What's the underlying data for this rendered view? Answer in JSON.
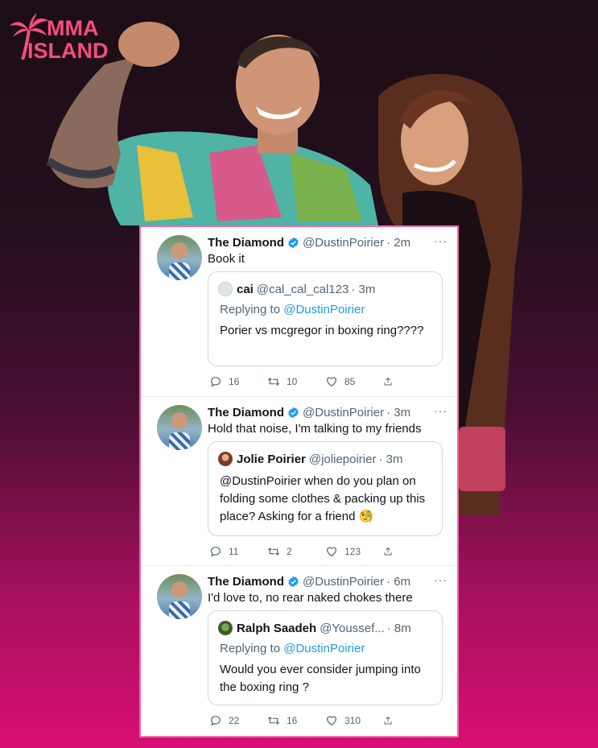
{
  "brand": {
    "line1": "MMA",
    "line2": "ISLAND",
    "color": "#f44e7c"
  },
  "tweets": [
    {
      "name": "The Diamond",
      "handle": "@DustinPoirier",
      "time": "· 2m",
      "text": "Book it",
      "quote": {
        "name": "cai",
        "handle": "@cal_cal_cal123",
        "time": "· 3m",
        "replying_prefix": "Replying to ",
        "replying_to": "@DustinPoirier",
        "text": "Porier vs mcgregor in boxing ring????"
      },
      "replies": "16",
      "retweets": "10",
      "likes": "85"
    },
    {
      "name": "The Diamond",
      "handle": "@DustinPoirier",
      "time": "· 3m",
      "text": "Hold that noise, I'm talking to my friends",
      "quote": {
        "name": "Jolie Poirier",
        "handle": "@joliepoirier",
        "time": "· 3m",
        "text": "@DustinPoirier when do you plan on folding some clothes & packing up this place? Asking for a friend 🧐"
      },
      "replies": "11",
      "retweets": "2",
      "likes": "123"
    },
    {
      "name": "The Diamond",
      "handle": "@DustinPoirier",
      "time": "· 6m",
      "text": "I'd love to, no rear naked chokes there",
      "quote": {
        "name": "Ralph Saadeh",
        "handle": "@Youssef...",
        "time": "· 8m",
        "replying_prefix": "Replying to ",
        "replying_to": "@DustinPoirier",
        "text": "Would you ever consider jumping into the boxing ring ?"
      },
      "replies": "22",
      "retweets": "16",
      "likes": "310"
    }
  ],
  "icons": {
    "verified": "verified-badge-icon",
    "reply": "reply-icon",
    "retweet": "retweet-icon",
    "like": "heart-icon",
    "share": "share-icon",
    "more": "more-dots-icon"
  },
  "colors": {
    "link": "#1d9bf0",
    "muted": "#536471",
    "card_border": "#f06aa3"
  }
}
